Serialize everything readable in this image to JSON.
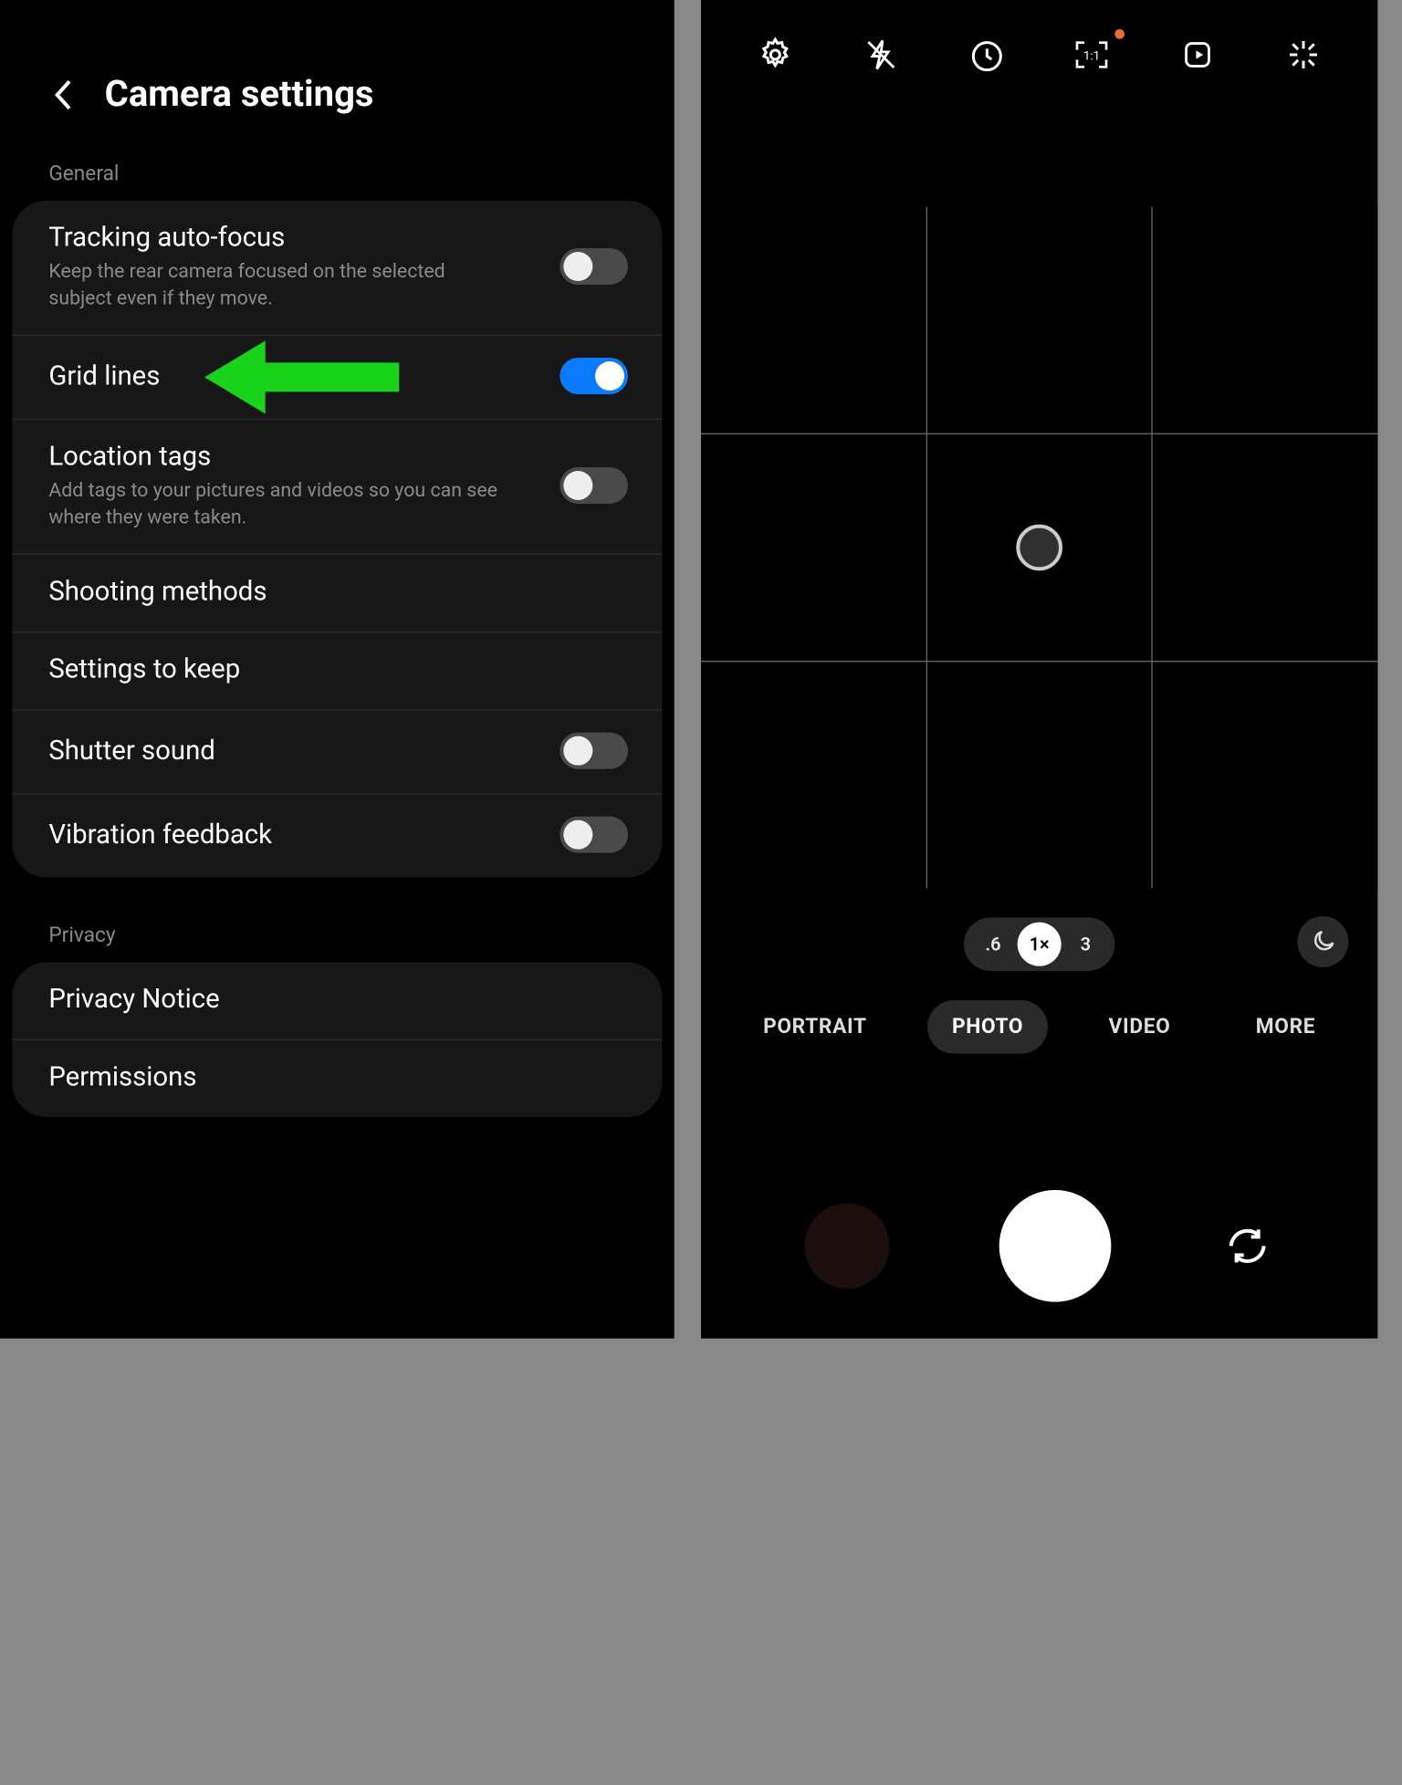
{
  "settings": {
    "title": "Camera settings",
    "section_general": "General",
    "section_privacy": "Privacy",
    "tracking": {
      "label": "Tracking auto-focus",
      "sub": "Keep the rear camera focused on the selected subject even if they move.",
      "on": false
    },
    "grid": {
      "label": "Grid lines",
      "on": true
    },
    "location": {
      "label": "Location tags",
      "sub": "Add tags to your pictures and videos so you can see where they were taken.",
      "on": false
    },
    "shooting": {
      "label": "Shooting methods"
    },
    "keep": {
      "label": "Settings to keep"
    },
    "shutter": {
      "label": "Shutter sound",
      "on": false
    },
    "vibration": {
      "label": "Vibration feedback",
      "on": false
    },
    "privacy_notice": {
      "label": "Privacy Notice"
    },
    "permissions": {
      "label": "Permissions"
    }
  },
  "camera": {
    "zoom": {
      "wide": ".6",
      "normal": "1×",
      "tele": "3",
      "selected": "normal"
    },
    "modes": {
      "portrait": "PORTRAIT",
      "photo": "PHOTO",
      "video": "VIDEO",
      "more": "MORE",
      "selected": "photo"
    }
  }
}
